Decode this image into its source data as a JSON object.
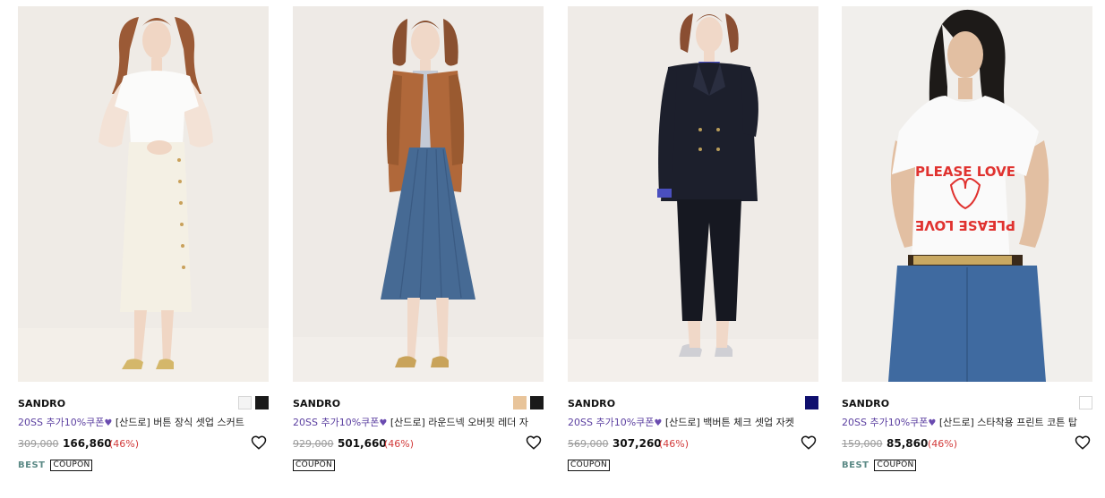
{
  "products": [
    {
      "brand": "SANDRO",
      "promo": "20SS 추가10%쿠폰",
      "name": "[산드로] 버튼 장식 셋업 스커트",
      "original_price": "309,000",
      "sale_price": "166,860",
      "discount": "(46%)",
      "swatches": [
        "#f4f4f4",
        "#1a1a1a"
      ],
      "best": "BEST",
      "coupon": "COUPON",
      "image_icon": "model-photo-white-skirt"
    },
    {
      "brand": "SANDRO",
      "promo": "20SS 추가10%쿠폰",
      "name": "[산드로] 라운드넥 오버핏 레더 자",
      "original_price": "929,000",
      "sale_price": "501,660",
      "discount": "(46%)",
      "swatches": [
        "#e8c49a",
        "#1a1a1a"
      ],
      "best": "",
      "coupon": "COUPON",
      "image_icon": "model-photo-leather-jacket"
    },
    {
      "brand": "SANDRO",
      "promo": "20SS 추가10%쿠폰",
      "name": "[산드로] 백버튼 체크 셋업 자켓",
      "original_price": "569,000",
      "sale_price": "307,260",
      "discount": "(46%)",
      "swatches": [
        "#0f0f6e"
      ],
      "best": "",
      "coupon": "COUPON",
      "image_icon": "model-photo-navy-suit"
    },
    {
      "brand": "SANDRO",
      "promo": "20SS 추가10%쿠폰",
      "name": "[산드로] 스타착용 프린트 코튼 탑",
      "original_price": "159,000",
      "sale_price": "85,860",
      "discount": "(46%)",
      "swatches": [
        "#ffffff"
      ],
      "best": "BEST",
      "coupon": "COUPON",
      "image_icon": "model-photo-print-tee",
      "print_text": "PLEASE LOVE"
    }
  ],
  "colors": {
    "promo": "#5b3fa0",
    "discount": "#d23a3a",
    "best": "#5c8a86",
    "wishlist_icon": "heart-outline-icon"
  }
}
